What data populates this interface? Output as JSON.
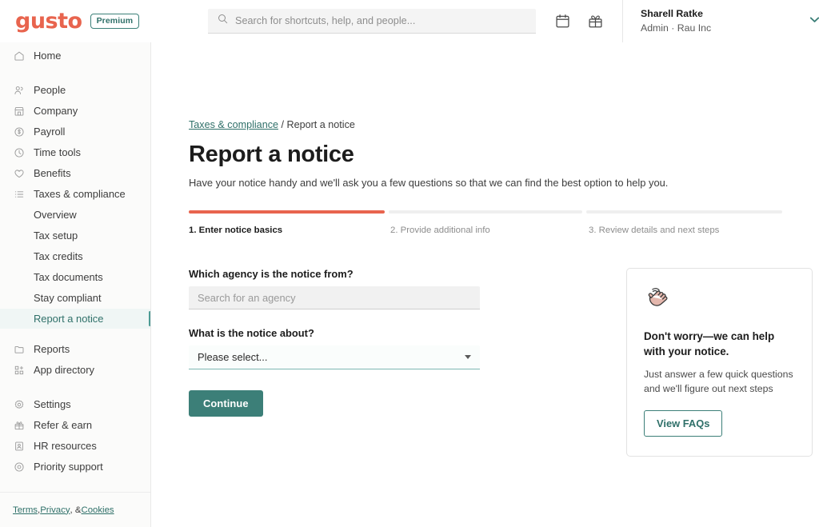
{
  "topbar": {
    "logo_text": "gusto",
    "plan_badge": "Premium",
    "search_placeholder": "Search for shortcuts, help, and people...",
    "calendar_icon": "calendar-icon",
    "gift_icon": "gift-icon",
    "account_name": "Sharell Ratke",
    "account_sub": "Admin · Rau Inc",
    "chevron_icon": "chevron-down-icon"
  },
  "sidebar": {
    "primary": [
      {
        "label": "Home",
        "icon": "home-icon"
      }
    ],
    "groups": [
      {
        "label": "People",
        "icon": "people-icon"
      },
      {
        "label": "Company",
        "icon": "company-icon"
      },
      {
        "label": "Payroll",
        "icon": "payroll-icon"
      },
      {
        "label": "Time tools",
        "icon": "clock-icon"
      },
      {
        "label": "Benefits",
        "icon": "heart-icon"
      },
      {
        "label": "Taxes & compliance",
        "icon": "list-icon"
      }
    ],
    "sub_items": [
      {
        "label": "Overview",
        "active": false
      },
      {
        "label": "Tax setup",
        "active": false
      },
      {
        "label": "Tax credits",
        "active": false
      },
      {
        "label": "Tax documents",
        "active": false
      },
      {
        "label": "Stay compliant",
        "active": false
      },
      {
        "label": "Report a notice",
        "active": true
      }
    ],
    "secondary": [
      {
        "label": "Reports",
        "icon": "folder-icon"
      },
      {
        "label": "App directory",
        "icon": "apps-icon"
      }
    ],
    "tertiary": [
      {
        "label": "Settings",
        "icon": "gear-icon"
      },
      {
        "label": "Refer & earn",
        "icon": "gift-icon"
      },
      {
        "label": "HR resources",
        "icon": "id-card-icon"
      },
      {
        "label": "Priority support",
        "icon": "support-icon"
      }
    ],
    "footer": {
      "terms": "Terms",
      "privacy": "Privacy",
      "cookies": "Cookies",
      "sep1": ", ",
      "sep2": ", & "
    }
  },
  "main": {
    "breadcrumb_link": "Taxes & compliance",
    "breadcrumb_sep": " / ",
    "breadcrumb_current": "Report a notice",
    "title": "Report a notice",
    "description": "Have your notice handy and we'll ask you a few questions so that we can find the best option to help you.",
    "steps": [
      {
        "label": "1. Enter notice basics",
        "done": true
      },
      {
        "label": "2. Provide additional info",
        "done": false
      },
      {
        "label": "3. Review details and next steps",
        "done": false
      }
    ],
    "form": {
      "agency_label": "Which agency is the notice from?",
      "agency_placeholder": "Search for an agency",
      "about_label": "What is the notice about?",
      "about_value": "Please select...",
      "continue_label": "Continue"
    },
    "help_card": {
      "icon": "waving-hand-icon",
      "title": "Don't worry—we can help with your notice.",
      "body": "Just answer a few quick questions and we'll figure out next steps",
      "button_label": "View FAQs"
    }
  },
  "colors": {
    "brand_coral": "#e8644e",
    "accent_teal": "#3c7f78",
    "active_teal": "#2f7069",
    "sidebar_bg": "#fbfbfa"
  }
}
